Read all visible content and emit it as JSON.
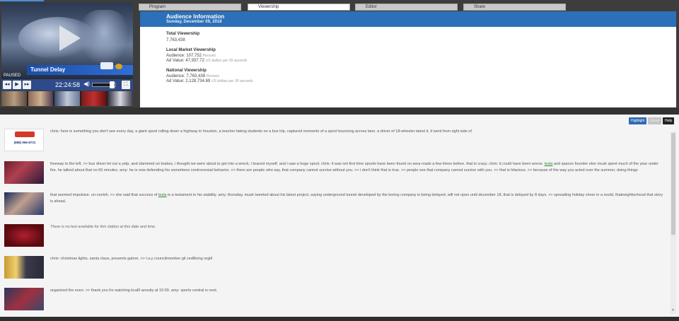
{
  "player": {
    "lower_third_title": "Tunnel Delay",
    "status": "PAUSED",
    "time": "22:24:58",
    "controls": {
      "prev": "◂◂",
      "play": "▶",
      "next": "▸▸",
      "fullscreen": "⛶",
      "volume": "◀)"
    }
  },
  "tabs": [
    "Program",
    "Viewership",
    "Editor",
    "Share"
  ],
  "active_tab": "Viewership",
  "audience": {
    "title": "Audience Information",
    "date": "Sunday, December 09, 2018",
    "total": {
      "label": "Total Viewership",
      "value": "7,763,438"
    },
    "local": {
      "label": "Local Market Viewership",
      "audience_label": "Audience: 107,752",
      "audience_unit": "Persons",
      "ad_label": "Ad Value: 47,937.72",
      "ad_unit": "US dollars per 30 seconds"
    },
    "national": {
      "label": "National Viewership",
      "audience_label": "Audience: 7,763,438",
      "audience_unit": "Persons",
      "ad_label": "Ad Value: 2,128,734.69",
      "ad_unit": "US dollars per 30 seconds"
    }
  },
  "toolbar": {
    "highlight": "Highlight",
    "email": "Email",
    "help": "Help"
  },
  "transcript": [
    {
      "text": "chris: here is something you don't see every day, a giant spool rolling down a highway in houston, a teacher taking students on a bus trip, captured moments of a spool bouncing across lane. a driver of 18-wheeler latest it, it went from right side of"
    },
    {
      "text_a": "freeway to the left. >> bus driver let out a yelp, and slammed on brakes, i thought we were about to get into a wreck, i braced myself. and i saw a huge spool. chris: it was not first time spools have been found on area roads a few times before. that is crazy. chris: it could have been worse. ",
      "keyword": "tesla",
      "text_b": " and spacex founder elon musk spent much of the year under fire. he talked about that on 60 minutes. amy: he is now defending his sometimes controversial behavior. >> there are people who say, that company cannot survive without you. >> i don't think that is true. >> people see that company cannot survive with you. >> that is hilarious. >> because of the way you acted over the summer, doing things"
    },
    {
      "text_a": "that seemed impulsive. un-ceolsh. >> she said that success of ",
      "keyword": "tesla",
      "text_b": " is a testament to his stability. amy: thursday, musk tweeted about his latest project, saying underground tunnel developed by the boring company is being delayed, will not open until december 18, that is delayed by 8 days. >> spreading holiday cheer in a noold, thatneighborhood that story is ahead."
    },
    {
      "text": "There is no text available for this station at this date and time."
    },
    {
      "text": "chris: christmas lights, santa claus, presents galore. >> l.a.y councilmember gil cedilloing orgill"
    },
    {
      "text": "organized the even. >> thank you for watching kcal9 annuity at 10:00. amy: sports central is next."
    }
  ],
  "thumb_texts": {
    "phone": "(888) 966-8731"
  }
}
